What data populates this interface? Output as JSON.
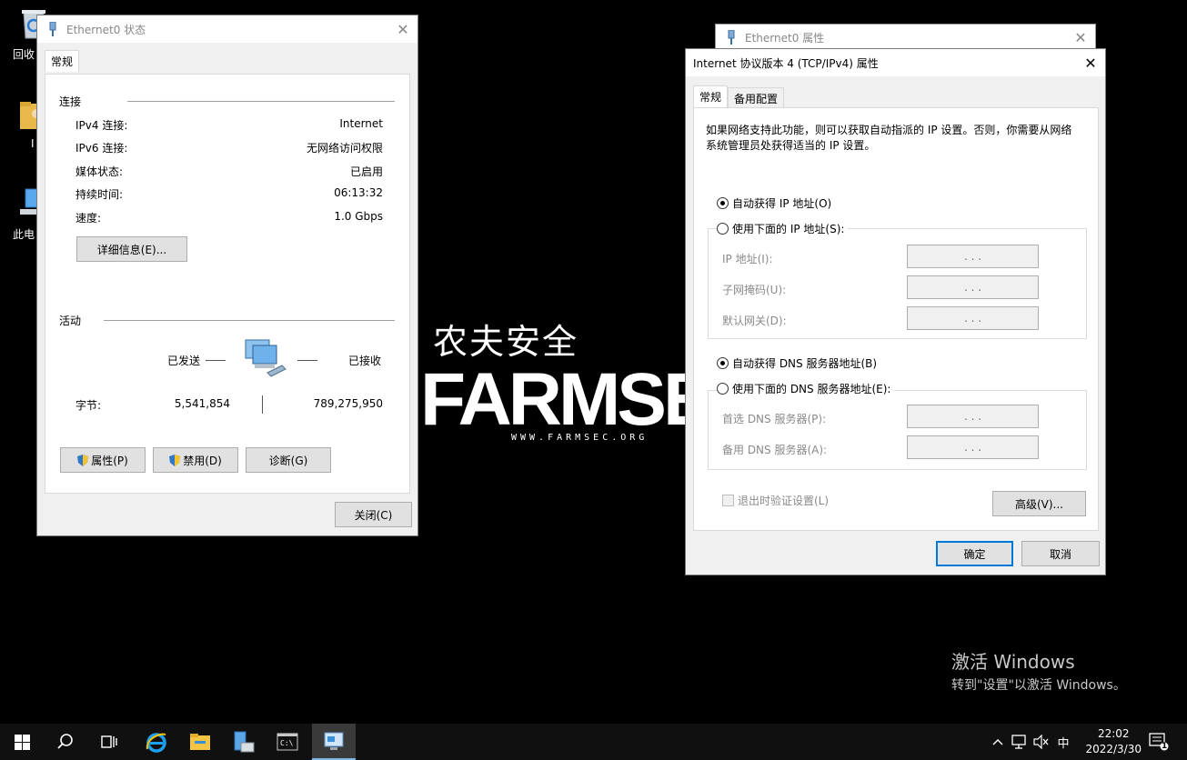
{
  "desktop": {
    "icons": [
      {
        "label": "回收",
        "icon": "recycle-bin-icon"
      },
      {
        "label": "I",
        "icon": "user-folder-icon"
      },
      {
        "label": "此电",
        "icon": "this-pc-icon"
      }
    ],
    "logo": {
      "cn": "农夫安全",
      "big": "FARMSE",
      "url": "WWW.FARMSEC.ORG"
    }
  },
  "status_dialog": {
    "title": "Ethernet0 状态",
    "tab": "常规",
    "connection": {
      "group": "连接",
      "rows": [
        {
          "label": "IPv4 连接:",
          "value": "Internet"
        },
        {
          "label": "IPv6 连接:",
          "value": "无网络访问权限"
        },
        {
          "label": "媒体状态:",
          "value": "已启用"
        },
        {
          "label": "持续时间:",
          "value": "06:13:32"
        },
        {
          "label": "速度:",
          "value": "1.0 Gbps"
        }
      ],
      "details_button": "详细信息(E)..."
    },
    "activity": {
      "group": "活动",
      "sent_label": "已发送",
      "recv_label": "已接收",
      "bytes_label": "字节:",
      "bytes_sent": "5,541,854",
      "bytes_recv": "789,275,950"
    },
    "buttons": {
      "properties": "属性(P)",
      "disable": "禁用(D)",
      "diagnose": "诊断(G)"
    },
    "close": "关闭(C)"
  },
  "props_dialog": {
    "title": "Ethernet0 属性"
  },
  "tcp_dialog": {
    "title": "Internet 协议版本 4 (TCP/IPv4) 属性",
    "tabs": [
      "常规",
      "备用配置"
    ],
    "description": "如果网络支持此功能，则可以获取自动指派的 IP 设置。否则，你需要从网络系统管理员处获得适当的 IP 设置。",
    "ip": {
      "auto": "自动获得 IP 地址(O)",
      "manual": "使用下面的 IP 地址(S):",
      "auto_checked": true,
      "fields": [
        {
          "label": "IP 地址(I):",
          "value": ".   .   ."
        },
        {
          "label": "子网掩码(U):",
          "value": ".   .   ."
        },
        {
          "label": "默认网关(D):",
          "value": ".   .   ."
        }
      ]
    },
    "dns": {
      "auto": "自动获得 DNS 服务器地址(B)",
      "manual": "使用下面的 DNS 服务器地址(E):",
      "auto_checked": true,
      "fields": [
        {
          "label": "首选 DNS 服务器(P):",
          "value": ".   .   ."
        },
        {
          "label": "备用 DNS 服务器(A):",
          "value": ".   .   ."
        }
      ]
    },
    "validate": "退出时验证设置(L)",
    "advanced": "高级(V)...",
    "ok": "确定",
    "cancel": "取消"
  },
  "watermark": {
    "line1": "激活 Windows",
    "line2": "转到\"设置\"以激活 Windows。"
  },
  "taskbar": {
    "items": [
      "start-icon",
      "search-icon",
      "task-view-icon",
      "internet-explorer-icon",
      "file-explorer-icon",
      "server-manager-icon",
      "command-prompt-icon",
      "network-connections-icon"
    ],
    "tray": {
      "ime": "中",
      "time": "22:02",
      "date": "2022/3/30",
      "notifications": "1"
    }
  }
}
